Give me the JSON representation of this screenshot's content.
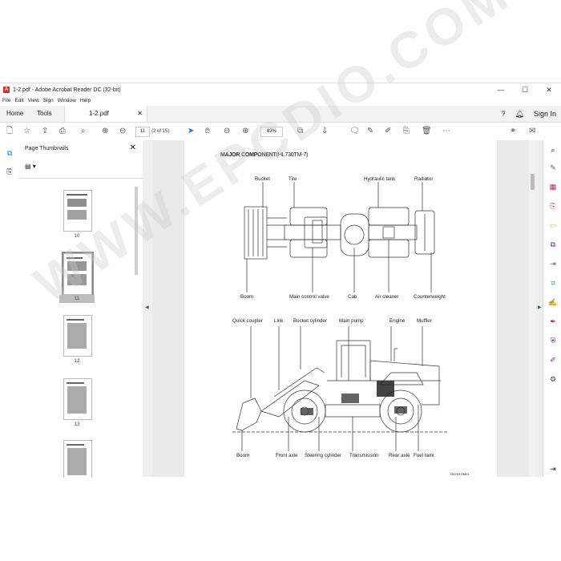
{
  "window": {
    "title": "1-2.pdf - Adobe Acrobat Reader DC (32-bit)",
    "controls": [
      "—",
      "☐",
      "✕"
    ]
  },
  "menu": [
    "File",
    "Edit",
    "View",
    "Sign",
    "Window",
    "Help"
  ],
  "tabs": {
    "home": "Home",
    "tools": "Tools",
    "document": "1-2.pdf"
  },
  "header_right": {
    "sign_in": "Sign In"
  },
  "toolbar": {
    "page_number": "11",
    "page_count": "(2 of 15)",
    "zoom": "83%"
  },
  "thumbnails_panel": {
    "title": "Page Thumbnails",
    "pages": [
      "10",
      "11",
      "12",
      "13"
    ]
  },
  "document": {
    "heading": "MAJOR COMPONENT",
    "model": "(HL730TM-7)",
    "top_view_labels": {
      "bucket": "Bucket",
      "tire": "Tire",
      "hydraulic_tank": "Hydraulic tank",
      "radiator": "Radiator",
      "boom": "Boom",
      "main_control_valve": "Main control valve",
      "cab": "Cab",
      "air_cleaner": "Air cleaner",
      "counterweight": "Counterweight"
    },
    "side_view_labels": {
      "quick_coupler": "Quick coupler",
      "link": "Link",
      "bucket_cylinder": "Bucket cylinder",
      "main_pump": "Main pump",
      "engine": "Engine",
      "muffler": "Muffler",
      "boom": "Boom",
      "front_axle": "Front axle",
      "steering_cylinder": "Steering cylinder",
      "transmission": "Transmission",
      "rear_axle": "Rear axle",
      "fuel_tank": "Fuel tank"
    },
    "figure_code": "7807ATOM01"
  },
  "watermark": "WWW.EPCDIO.COM"
}
